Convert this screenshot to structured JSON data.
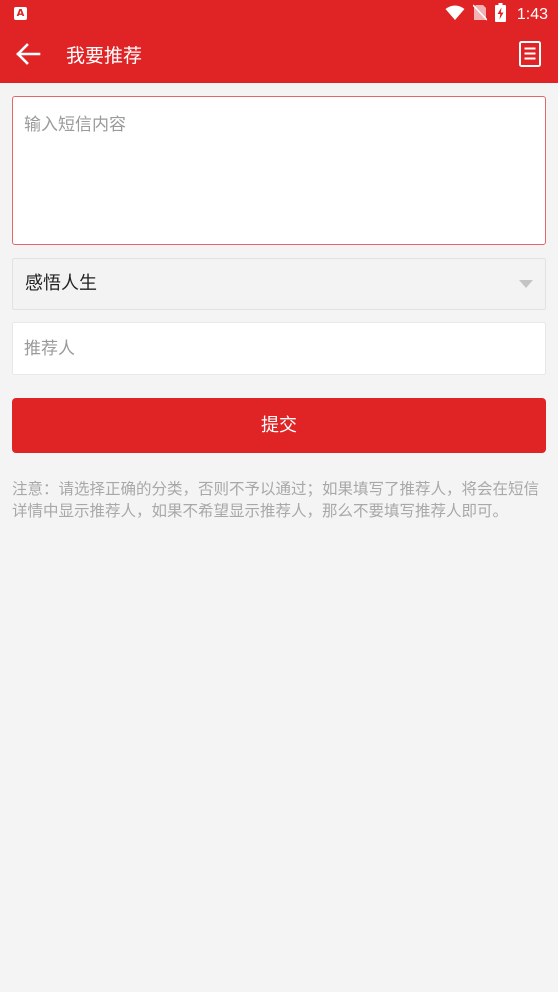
{
  "status_bar": {
    "app_icon": "A",
    "time": "1:43",
    "icons": [
      "wifi-icon",
      "no-sim-icon",
      "battery-charging-icon"
    ]
  },
  "app_bar": {
    "title": "我要推荐",
    "back_icon": "arrow-left-icon",
    "menu_icon": "document-list-icon"
  },
  "form": {
    "sms_content": {
      "placeholder": "输入短信内容",
      "value": ""
    },
    "category": {
      "selected": "感悟人生"
    },
    "recommender": {
      "placeholder": "推荐人",
      "value": ""
    },
    "submit_label": "提交"
  },
  "notice": "注意：请选择正确的分类，否则不予以通过；如果填写了推荐人，将会在短信详情中显示推荐人，如果不希望显示推荐人，那么不要填写推荐人即可。",
  "colors": {
    "primary": "#e02426",
    "background": "#f4f4f4",
    "hint_text": "#a8a8a8",
    "input_border_focus": "#e2676a"
  }
}
